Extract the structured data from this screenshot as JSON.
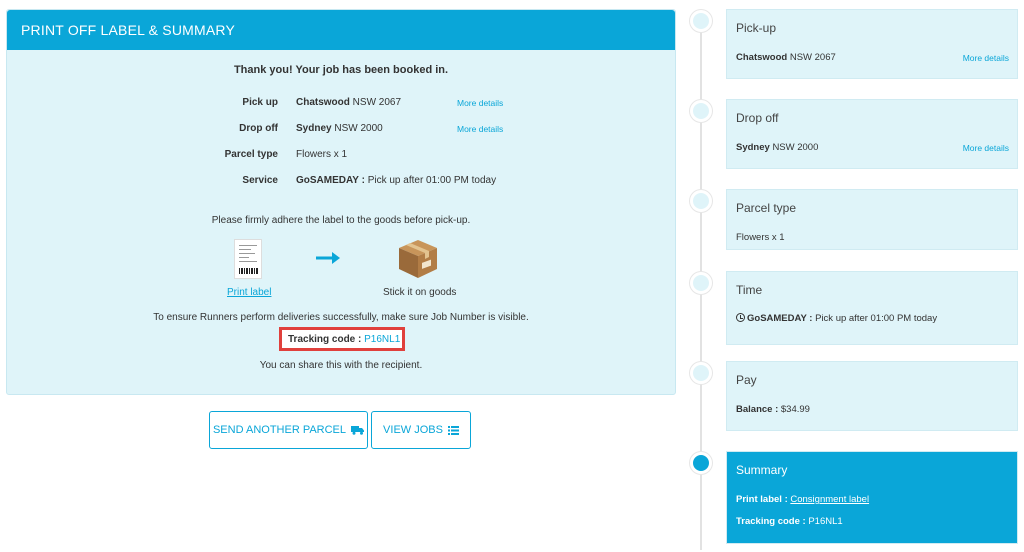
{
  "main": {
    "header": "PRINT OFF LABEL & SUMMARY",
    "thanks": "Thank you! Your job has been booked in.",
    "rows": [
      {
        "label": "Pick up",
        "value_bold": "Chatswood",
        "value": "NSW 2067",
        "more": "More details"
      },
      {
        "label": "Drop off",
        "value_bold": "Sydney",
        "value": "NSW 2000",
        "more": "More details"
      },
      {
        "label": "Parcel type",
        "value_bold": "",
        "value": "Flowers x 1",
        "more": ""
      },
      {
        "label": "Service",
        "value_bold": "GoSAMEDAY :",
        "value": "Pick up after 01:00 PM today",
        "more": ""
      }
    ],
    "adhere": "Please firmly adhere the label to the goods before pick-up.",
    "print_label": "Print label",
    "stick": "Stick it on goods",
    "ensure": "To ensure Runners perform deliveries successfully, make sure Job Number is visible.",
    "tracking_label": "Tracking code :",
    "tracking_value": "P16NL1",
    "share": "You can share this with the recipient."
  },
  "buttons": {
    "send_another": "SEND ANOTHER PARCEL",
    "view_jobs": "VIEW JOBS"
  },
  "steps": {
    "pickup": {
      "title": "Pick-up",
      "bold": "Chatswood",
      "value": "NSW 2067",
      "more": "More details"
    },
    "dropoff": {
      "title": "Drop off",
      "bold": "Sydney",
      "value": "NSW 2000",
      "more": "More details"
    },
    "parcel": {
      "title": "Parcel type",
      "value": "Flowers x 1"
    },
    "time": {
      "title": "Time",
      "bold": "GoSAMEDAY :",
      "value": "Pick up after 01:00 PM today"
    },
    "pay": {
      "title": "Pay",
      "bold": "Balance :",
      "value": "$34.99"
    },
    "summary": {
      "title": "Summary",
      "print_label": "Print label :",
      "print_link": "Consignment label",
      "tracking_label": "Tracking code :",
      "tracking_value": "P16NL1"
    }
  },
  "colors": {
    "accent": "#0aa6d8",
    "panel": "#dff4f9",
    "highlight": "#e0403c"
  },
  "icons": {
    "truck": "truck-icon",
    "list": "list-icon",
    "clock": "clock-icon",
    "arrow": "arrow-right-icon",
    "box": "box-icon",
    "label": "shipping-label-icon"
  }
}
